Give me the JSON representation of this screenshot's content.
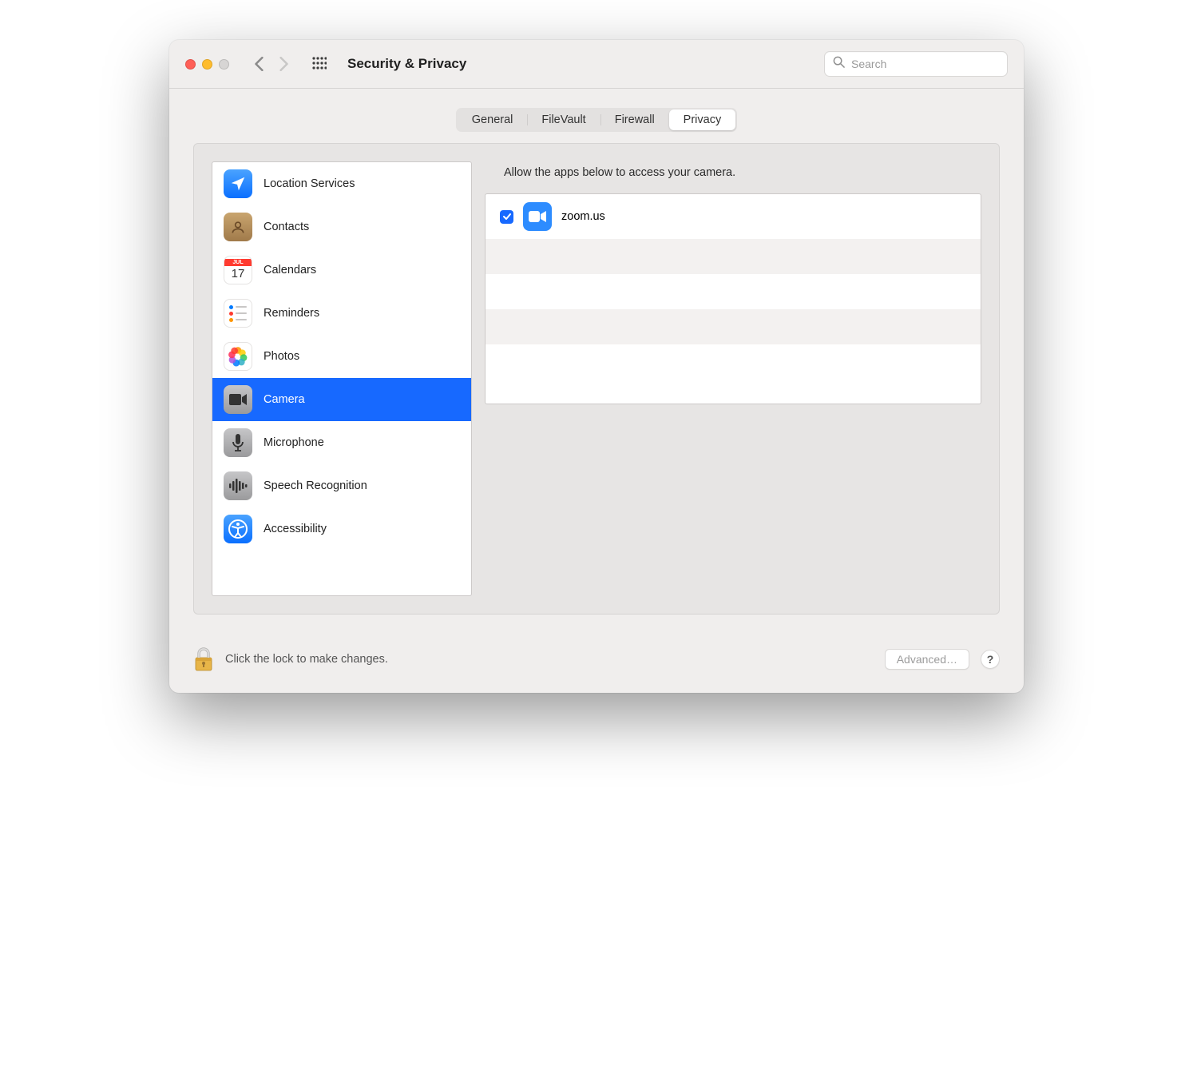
{
  "window": {
    "title": "Security & Privacy"
  },
  "search": {
    "placeholder": "Search"
  },
  "tabs": [
    {
      "label": "General"
    },
    {
      "label": "FileVault"
    },
    {
      "label": "Firewall"
    },
    {
      "label": "Privacy"
    }
  ],
  "sidebar": {
    "items": [
      {
        "label": "Location Services"
      },
      {
        "label": "Contacts"
      },
      {
        "label": "Calendars"
      },
      {
        "label": "Reminders"
      },
      {
        "label": "Photos"
      },
      {
        "label": "Camera"
      },
      {
        "label": "Microphone"
      },
      {
        "label": "Speech Recognition"
      },
      {
        "label": "Accessibility"
      }
    ]
  },
  "detail": {
    "description": "Allow the apps below to access your camera.",
    "apps": [
      {
        "name": "zoom.us",
        "checked": true
      }
    ]
  },
  "footer": {
    "lock_text": "Click the lock to make changes.",
    "advanced_label": "Advanced…",
    "help_label": "?"
  }
}
